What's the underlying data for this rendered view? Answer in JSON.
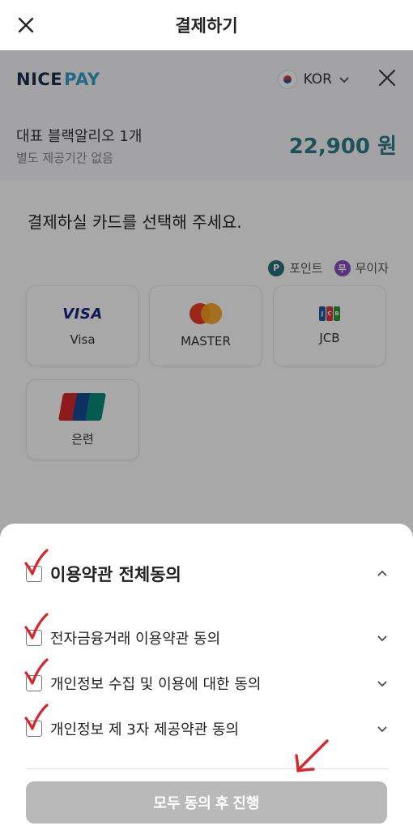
{
  "topbar": {
    "title": "결제하기"
  },
  "nicepay": {
    "logo_nice": "NICE",
    "logo_pay": "PAY",
    "language": "KOR",
    "product_name": "대표 블랙알리오 1개",
    "product_sub": "별도 제공기간 없음",
    "price": "22,900 원"
  },
  "card_select": {
    "title": "결제하실 카드를 선택해 주세요.",
    "badges": [
      {
        "icon": "P",
        "label": "포인트"
      },
      {
        "icon": "무",
        "label": "무이자"
      }
    ],
    "cards": [
      {
        "logo_text": "VISA",
        "label": "Visa"
      },
      {
        "logo_text": "",
        "label": "MASTER"
      },
      {
        "logo_text": "JCB",
        "label": "JCB"
      },
      {
        "logo_text": "UnionPay",
        "label": "은련"
      }
    ]
  },
  "terms": {
    "all_label": "이용약관 전체동의",
    "items": [
      {
        "label": "전자금융거래 이용약관 동의"
      },
      {
        "label": "개인정보 수집 및 이용에 대한 동의"
      },
      {
        "label": "개인정보 제 3자 제공약관 동의"
      }
    ],
    "submit_label": "모두 동의 후 진행"
  },
  "colors": {
    "price": "#2f7d86",
    "overlay": "rgba(0,0,0,0.34)",
    "submit_disabled": "#b9b9b9",
    "annotation_red": "#d8262d"
  }
}
